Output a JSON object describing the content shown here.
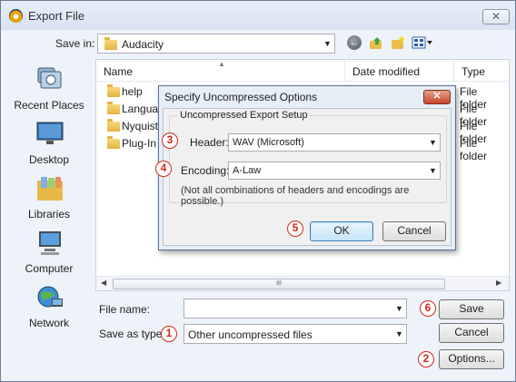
{
  "window": {
    "title": "Export File",
    "close_glyph": "✕"
  },
  "nav": {
    "save_in_label": "Save in:",
    "save_in_value": "Audacity",
    "toolbar_icons": [
      "back-icon",
      "up-folder-icon",
      "new-folder-icon",
      "view-menu-icon"
    ]
  },
  "places": [
    {
      "label": "Recent Places",
      "icon": "recent-places-icon"
    },
    {
      "label": "Desktop",
      "icon": "desktop-icon"
    },
    {
      "label": "Libraries",
      "icon": "libraries-icon"
    },
    {
      "label": "Computer",
      "icon": "computer-icon"
    },
    {
      "label": "Network",
      "icon": "network-icon"
    }
  ],
  "file_list": {
    "columns": [
      "Name",
      "Date modified",
      "Type"
    ],
    "rows": [
      {
        "name": "help",
        "type": "File folder"
      },
      {
        "name": "Langua",
        "type": "File folder"
      },
      {
        "name": "Nyquist",
        "type": "File folder"
      },
      {
        "name": "Plug-In",
        "type": "File folder"
      }
    ],
    "scroll_thumb_glyph": "III"
  },
  "form": {
    "file_name_label": "File name:",
    "file_name_value": "",
    "save_as_type_label": "Save as type:",
    "save_as_type_value": "Other uncompressed files",
    "save_button": "Save",
    "cancel_button": "Cancel",
    "options_button": "Options..."
  },
  "options_dialog": {
    "title": "Specify Uncompressed Options",
    "close_glyph": "✕",
    "group_title": "Uncompressed Export Setup",
    "header_label": "Header:",
    "header_value": "WAV (Microsoft)",
    "encoding_label": "Encoding:",
    "encoding_value": "A-Law",
    "note": "(Not all combinations of headers and encodings are possible.)",
    "ok_button": "OK",
    "cancel_button": "Cancel"
  },
  "markers": {
    "m1": "1",
    "m2": "2",
    "m3": "3",
    "m4": "4",
    "m5": "5",
    "m6": "6"
  },
  "colors": {
    "marker": "#d0281a",
    "title_bar": "#dfe8f4",
    "dialog_bg": "#eef3fa"
  }
}
